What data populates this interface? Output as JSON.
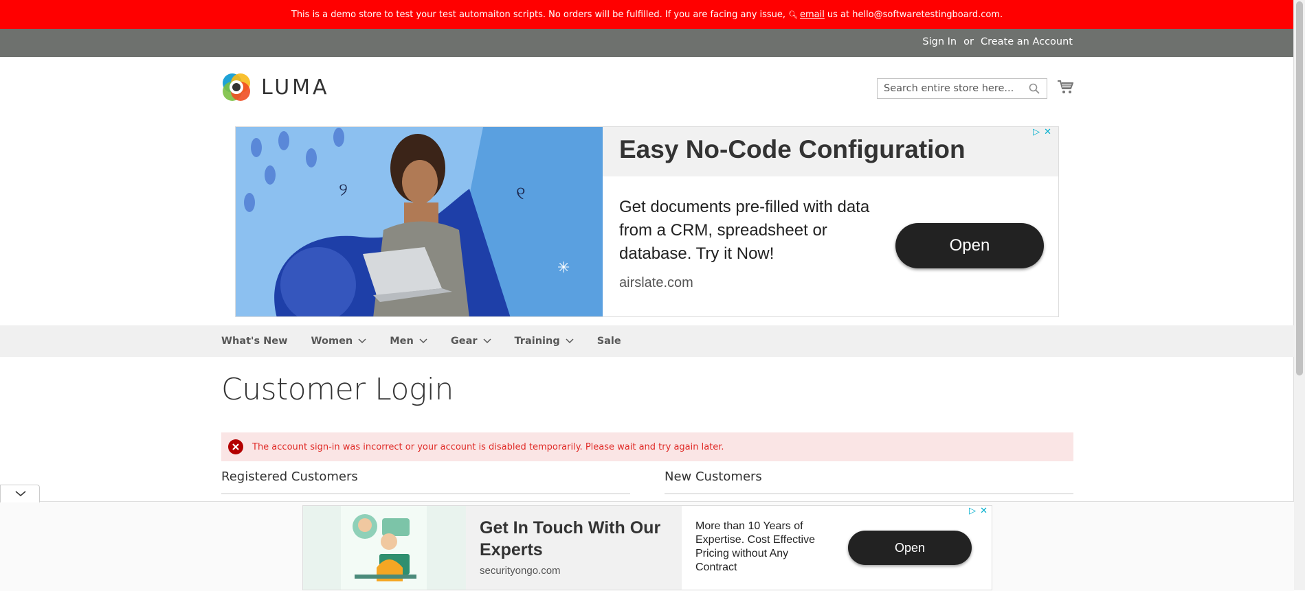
{
  "demo_notice": {
    "before": "This is a demo store to test your test automaiton scripts. No orders will be fulfilled. If you are facing any issue,",
    "link": "email",
    "after": "us at hello@softwaretestingboard.com."
  },
  "header": {
    "sign_in": "Sign In",
    "or": "or",
    "create_account": "Create an Account"
  },
  "logo": {
    "text": "LUMA"
  },
  "search": {
    "placeholder": "Search entire store here..."
  },
  "ad_top": {
    "title": "Easy No-Code Configuration",
    "body": "Get documents pre-filled with data from a CRM, spreadsheet or database. Try it Now!",
    "domain": "airslate.com",
    "cta": "Open"
  },
  "nav": {
    "items": [
      {
        "label": "What's New",
        "dropdown": false
      },
      {
        "label": "Women",
        "dropdown": true
      },
      {
        "label": "Men",
        "dropdown": true
      },
      {
        "label": "Gear",
        "dropdown": true
      },
      {
        "label": "Training",
        "dropdown": true
      },
      {
        "label": "Sale",
        "dropdown": false
      }
    ]
  },
  "page": {
    "title": "Customer Login",
    "error": "The account sign-in was incorrect or your account is disabled temporarily. Please wait and try again later.",
    "registered_title": "Registered Customers",
    "new_title": "New Customers"
  },
  "ad_bottom": {
    "title": "Get In Touch With Our Experts",
    "domain": "securityongo.com",
    "body": "More than 10 Years of Expertise. Cost Effective Pricing without Any Contract",
    "cta": "Open"
  },
  "colors": {
    "demo_bar": "#ff0000",
    "header": "#6e716e",
    "error_bg": "#fae5e5",
    "error_text": "#e02b27"
  }
}
